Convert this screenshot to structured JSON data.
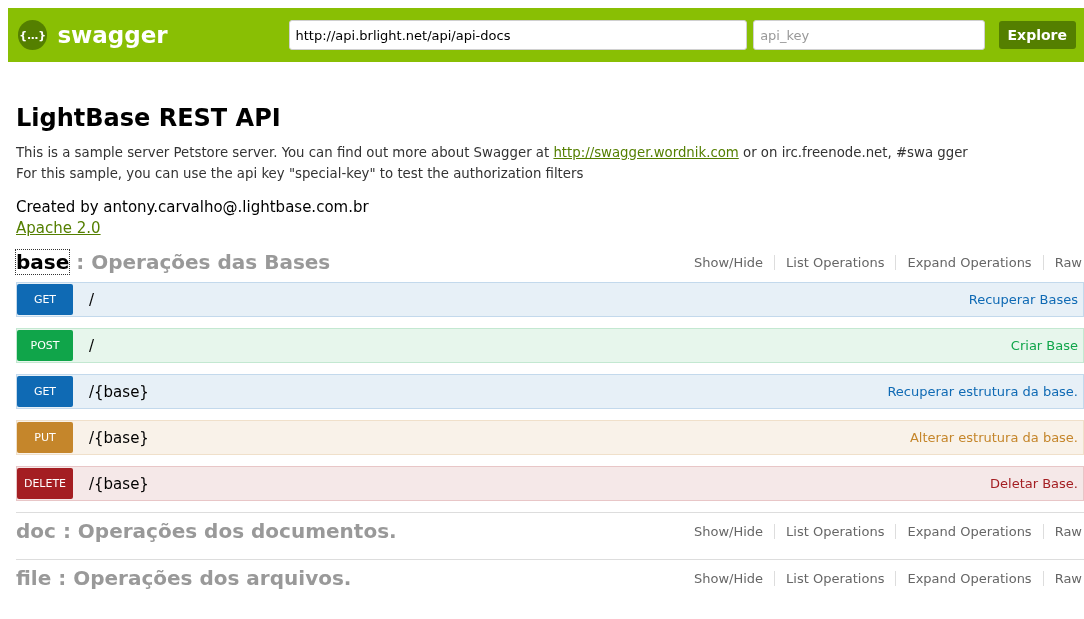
{
  "header": {
    "logo_symbol": "{…}",
    "logo_text": "swagger",
    "url": "http://api.brlight.net/api/api-docs",
    "api_key": {
      "placeholder": "api_key"
    },
    "button": "Explore"
  },
  "info": {
    "title": "LightBase REST API",
    "description_before": "This is a sample server Petstore server. You can find out more about Swagger at ",
    "description_link": "http://swagger.wordnik.com",
    "description_after": " or on irc.freenode.net, #swa gger",
    "description_line2": "For this sample, you can use the api key \"special-key\" to test the authorization filters",
    "contact": "Created by antony.carvalho@.lightbase.com.br",
    "license": "Apache 2.0"
  },
  "resources": [
    {
      "name": "base",
      "description": ": Operações das Bases",
      "expanded": true,
      "links": [
        "Show/Hide",
        "List Operations",
        "Expand Operations",
        "Raw"
      ],
      "operations": [
        {
          "method": "GET",
          "path": "/",
          "summary": "Recuperar Bases"
        },
        {
          "method": "POST",
          "path": "/",
          "summary": "Criar Base"
        },
        {
          "method": "GET",
          "path": "/{base}",
          "summary": "Recuperar estrutura da base."
        },
        {
          "method": "PUT",
          "path": "/{base}",
          "summary": "Alterar estrutura da base."
        },
        {
          "method": "DELETE",
          "path": "/{base}",
          "summary": "Deletar Base."
        }
      ]
    },
    {
      "name": "doc",
      "description": ": Operações dos documentos.",
      "expanded": false,
      "links": [
        "Show/Hide",
        "List Operations",
        "Expand Operations",
        "Raw"
      ]
    },
    {
      "name": "file",
      "description": ": Operações dos arquivos.",
      "expanded": false,
      "links": [
        "Show/Hide",
        "List Operations",
        "Expand Operations",
        "Raw"
      ]
    }
  ]
}
